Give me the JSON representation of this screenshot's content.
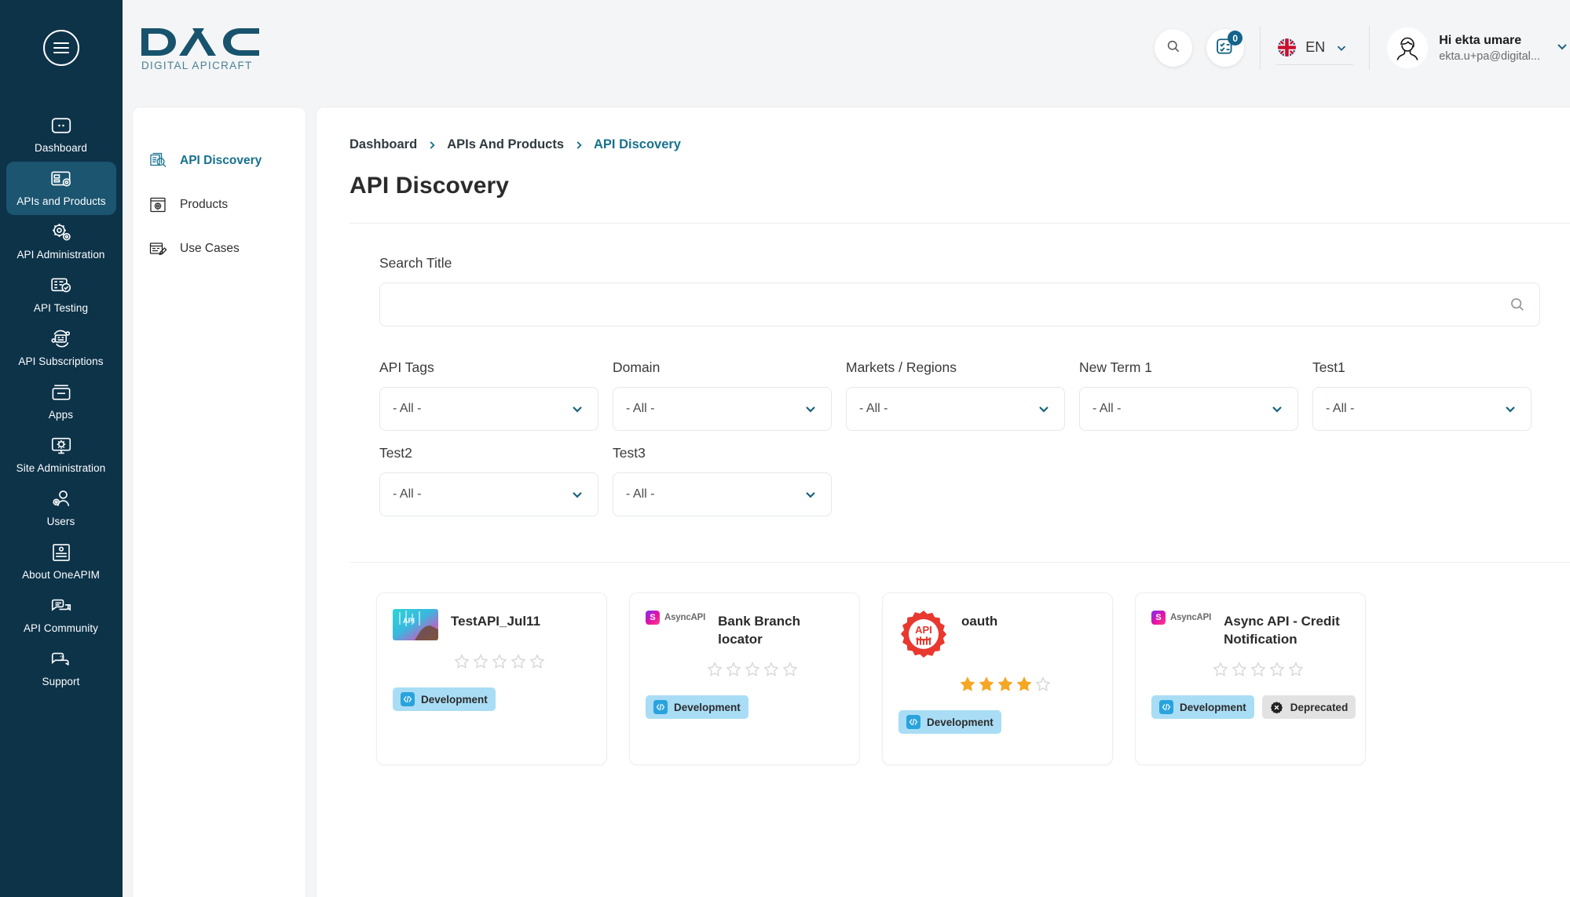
{
  "brand": {
    "name": "DAC",
    "tagline": "DIGITAL APICRAFT"
  },
  "rail": {
    "menu_label": "Menu",
    "items": [
      {
        "label": "Dashboard",
        "icon": "dashboard-icon",
        "active": false
      },
      {
        "label": "APIs and Products",
        "icon": "apis-products-icon",
        "active": true
      },
      {
        "label": "API Administration",
        "icon": "api-administration-icon",
        "active": false
      },
      {
        "label": "API Testing",
        "icon": "api-testing-icon",
        "active": false
      },
      {
        "label": "API Subscriptions",
        "icon": "api-subscriptions-icon",
        "active": false
      },
      {
        "label": "Apps",
        "icon": "apps-icon",
        "active": false
      },
      {
        "label": "Site Administration",
        "icon": "site-administration-icon",
        "active": false
      },
      {
        "label": "Users",
        "icon": "users-icon",
        "active": false
      },
      {
        "label": "About OneAPIM",
        "icon": "about-icon",
        "active": false
      },
      {
        "label": "API Community",
        "icon": "community-icon",
        "active": false
      },
      {
        "label": "Support",
        "icon": "support-icon",
        "active": false
      }
    ]
  },
  "topbar": {
    "search_icon": "search-icon",
    "tasks_icon": "tasks-icon",
    "tasks_badge": "0",
    "language": {
      "code": "EN",
      "flag": "uk-flag-icon"
    },
    "user": {
      "greeting": "Hi ekta umare",
      "email": "ekta.u+pa@digital...",
      "avatar": "user-avatar-icon"
    }
  },
  "subnav": {
    "items": [
      {
        "label": "API Discovery",
        "icon": "api-discovery-icon",
        "active": true
      },
      {
        "label": "Products",
        "icon": "products-icon",
        "active": false
      },
      {
        "label": "Use Cases",
        "icon": "use-cases-icon",
        "active": false
      }
    ]
  },
  "main": {
    "breadcrumb": [
      "Dashboard",
      "APIs And Products",
      "API Discovery"
    ],
    "page_title": "API Discovery",
    "search": {
      "label": "Search Title",
      "value": "",
      "placeholder": ""
    },
    "filters": [
      {
        "label": "API Tags",
        "value": "- All -"
      },
      {
        "label": "Domain",
        "value": "- All -"
      },
      {
        "label": "Markets / Regions",
        "value": "- All -"
      },
      {
        "label": "New Term 1",
        "value": "- All -"
      },
      {
        "label": "Test1",
        "value": "- All -"
      },
      {
        "label": "Test2",
        "value": "- All -"
      },
      {
        "label": "Test3",
        "value": "- All -"
      }
    ],
    "cards": [
      {
        "title": "TestAPI_Jul11",
        "logo_type": "photo-thumb",
        "rating": 0,
        "chips": [
          {
            "label": "Development",
            "type": "dev"
          }
        ]
      },
      {
        "title": "Bank Branch locator",
        "logo_type": "asyncapi-logo",
        "logo_text": "AsyncAPI",
        "rating": 0,
        "chips": [
          {
            "label": "Development",
            "type": "dev"
          }
        ]
      },
      {
        "title": "oauth",
        "logo_type": "api-gear-logo",
        "logo_text": "API",
        "rating": 4,
        "chips": [
          {
            "label": "Development",
            "type": "dev"
          }
        ]
      },
      {
        "title": "Async API - Credit Notification",
        "logo_type": "asyncapi-logo",
        "logo_text": "AsyncAPI",
        "rating": 0,
        "chips": [
          {
            "label": "Development",
            "type": "dev"
          },
          {
            "label": "Deprecated",
            "type": "dep"
          }
        ]
      }
    ]
  },
  "colors": {
    "rail_bg": "#0d3349",
    "rail_active": "#1b5570",
    "accent": "#17718f",
    "chip_dev": "#a9ddf5",
    "chip_dep": "#e2e2e2",
    "star_filled": "#f5a623",
    "gear_red": "#e8382f"
  }
}
